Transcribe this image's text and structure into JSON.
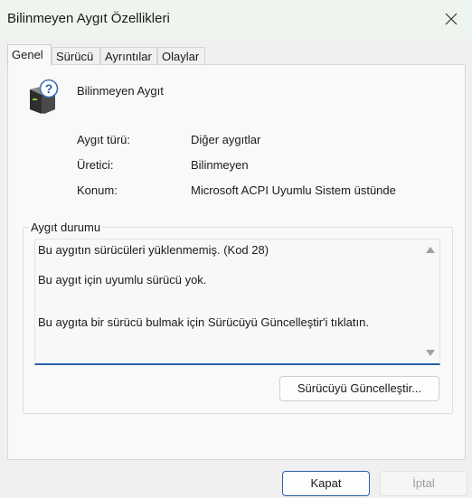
{
  "window": {
    "title": "Bilinmeyen Aygıt Özellikleri",
    "close_icon": "close-icon"
  },
  "tabs": [
    {
      "label": "Genel",
      "active": true
    },
    {
      "label": "Sürücü",
      "active": false
    },
    {
      "label": "Ayrıntılar",
      "active": false
    },
    {
      "label": "Olaylar",
      "active": false
    }
  ],
  "device": {
    "icon": "unknown-device-icon",
    "name": "Bilinmeyen Aygıt"
  },
  "properties": [
    {
      "label": "Aygıt türü:",
      "value": "Diğer aygıtlar"
    },
    {
      "label": "Üretici:",
      "value": "Bilinmeyen"
    },
    {
      "label": "Konum:",
      "value": "Microsoft ACPI Uyumlu Sistem üstünde"
    }
  ],
  "status": {
    "group_title": "Aygıt durumu",
    "lines": [
      "Bu aygıtın sürücüleri yüklenmemiş. (Kod 28)",
      "Bu aygıt için uyumlu sürücü yok.",
      "Bu aygıta bir sürücü bulmak için Sürücüyü Güncelleştir'i tıklatın."
    ],
    "update_button": "Sürücüyü Güncelleştir..."
  },
  "footer": {
    "ok_label": "Kapat",
    "cancel_label": "İptal"
  },
  "colors": {
    "accent": "#2a5fa8",
    "titlebar": "#eef5ee"
  }
}
